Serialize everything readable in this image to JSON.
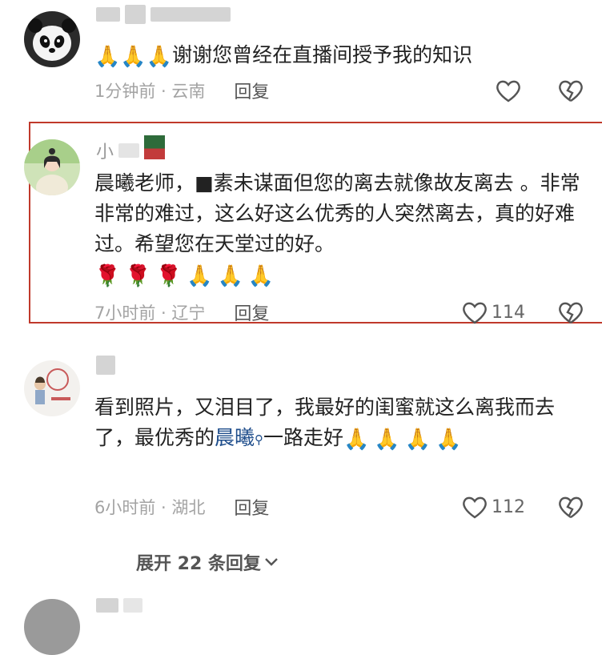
{
  "comments": [
    {
      "text": "谢谢您曾经在直播间授予我的知识",
      "emojis_prefix": "🙏🙏🙏",
      "time_location": "1分钟前 · 云南",
      "reply_label": "回复",
      "likes": ""
    },
    {
      "name_visible": "小",
      "text": "晨曦老师，■素未谋面但您的离去就像故友离去 。非常非常的难过，这么好这么优秀的人突然离去，真的好难过。希望您在天堂过的好。",
      "emojis_suffix": "🌹🌹🌹🙏🙏🙏",
      "time_location": "7小时前 · 辽宁",
      "reply_label": "回复",
      "likes": "114"
    },
    {
      "text_before": "看到照片，又泪目了，我最好的闺蜜就这么离我而去了，最优秀的",
      "mention": "晨曦",
      "text_after": "一路走好",
      "emojis_suffix": "🙏🙏🙏🙏",
      "time_location": "6小时前 · 湖北",
      "reply_label": "回复",
      "likes": "112"
    }
  ],
  "expand_replies": "展开 22 条回复",
  "icons": {
    "like": "heart-outline-icon",
    "dislike": "broken-heart-icon",
    "expand": "chevron-down-icon",
    "search": "search-icon"
  },
  "colors": {
    "highlight_border": "#c0392b",
    "mention": "#1f4e8c",
    "meta_text": "#a3a3a3"
  }
}
